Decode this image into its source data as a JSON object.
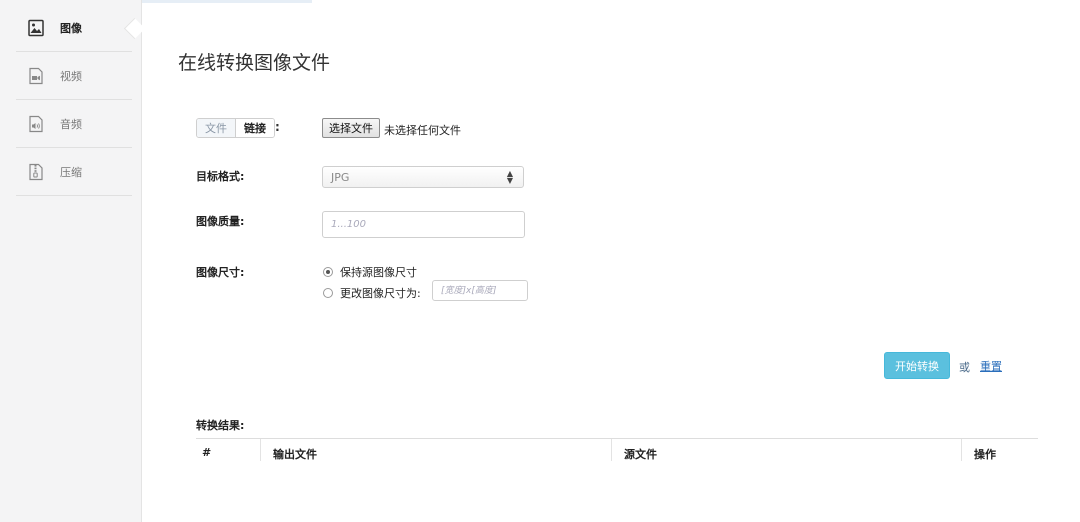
{
  "sidebar": {
    "items": [
      {
        "label": "图像",
        "icon": "image-file-icon",
        "active": true
      },
      {
        "label": "视频",
        "icon": "video-file-icon",
        "active": false
      },
      {
        "label": "音频",
        "icon": "audio-file-icon",
        "active": false
      },
      {
        "label": "压缩",
        "icon": "archive-file-icon",
        "active": false
      }
    ]
  },
  "main": {
    "title": "在线转换图像文件",
    "source": {
      "tab_file": "文件",
      "tab_link": "链接",
      "colon": ":",
      "file_button": "选择文件",
      "file_status": "未选择任何文件"
    },
    "target_format": {
      "label": "目标格式:",
      "selected": "JPG"
    },
    "quality": {
      "label": "图像质量:",
      "placeholder": "1...100"
    },
    "size": {
      "label": "图像尺寸:",
      "option_keep": "保持源图像尺寸",
      "option_change": "更改图像尺寸为:",
      "dims_placeholder": "[宽度]x[高度]"
    },
    "actions": {
      "start": "开始转换",
      "or": "或",
      "reset": "重置"
    },
    "results": {
      "label": "转换结果:",
      "columns": [
        "#",
        "输出文件",
        "源文件",
        "操作"
      ]
    }
  },
  "colors": {
    "accent": "#5bc0de",
    "link": "#2a6ebb",
    "sidebar_bg": "#f4f4f5"
  }
}
